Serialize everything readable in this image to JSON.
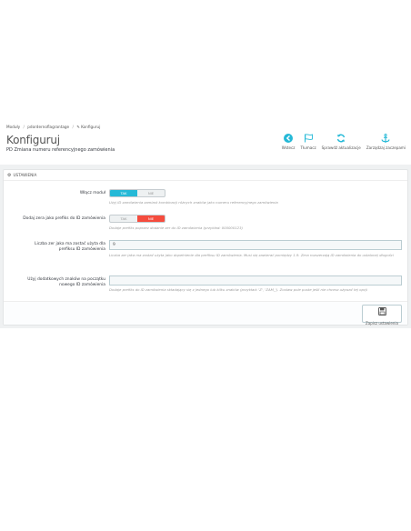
{
  "breadcrumb": {
    "item1": "Moduły",
    "item2": "pdordernoflagrantage",
    "item3": "Konfiguruj"
  },
  "header": {
    "title": "Konfiguruj",
    "subtitle": "PD Zmiana numeru referencyjnego zamówienia"
  },
  "toolbar": {
    "back_label": "Wstecz",
    "translate_label": "Tłumacz",
    "check_updates_label": "Sprawdź aktualizacje",
    "manage_hooks_label": "Zarządzaj zaczepami"
  },
  "panel": {
    "heading": "USTAWIENIA"
  },
  "settings": {
    "enable_module": {
      "label": "Włącz moduł",
      "on_text": "TAK",
      "off_text": "NIE",
      "help": "Użyj ID zamówienia zamiast kombinacji różnych znaków jako numeru referencyjnego zamówienia"
    },
    "add_zeros": {
      "label": "Dodaj zera jako prefiks do ID zamówienia",
      "on_text": "TAK",
      "off_text": "NIE",
      "help": "Dodaje prefiks poprzez dodanie zer do ID zamówienia (przykład: 000000123)"
    },
    "zero_count": {
      "label": "Liczba zer jaka ma zostać użyta dla prefiksu ID zamówienia",
      "value": "9",
      "help": "Liczba zer jaka ma zostać użyta jako dopełnienie dla prefiksu ID zamówienia. Musi się zawierać pomiędzy 1-9. Zera rozszerzają ID zamówienia do ustalonej długości"
    },
    "extra_chars": {
      "label": "Użyj dodatkowych znaków na początku nowego ID zamówienia",
      "value": "",
      "help": "Dodaje prefiks do ID zamówienia składający się z jednego lub kilku znaków (przykład: 'Z', 'ZAM_'). Zostaw pole puste jeśli nie chcesz używać tej opcji"
    }
  },
  "footer": {
    "save_label": "Zapisz ustawienia"
  },
  "colors": {
    "accent_blue": "#25b9d7",
    "accent_red": "#f54c3e"
  }
}
